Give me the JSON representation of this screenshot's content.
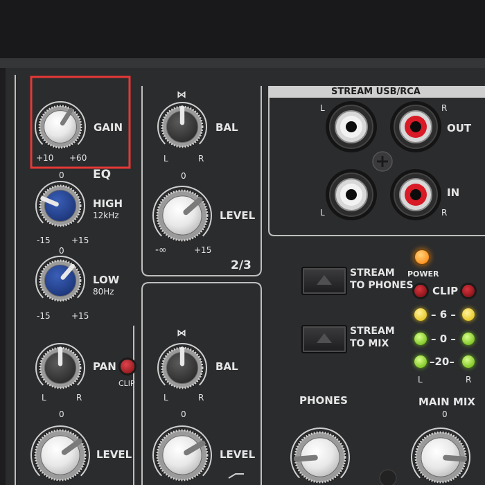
{
  "colors": {
    "panel": "#2b2c2e",
    "top_strip": "#1a1a1c",
    "line": "#c8c8c8",
    "highlight": "#e53935",
    "eq_knob": "#1f3f8c",
    "led_power": "#ff8a00",
    "led_clip": "#b3121b",
    "led_yellow": "#f4d21a",
    "led_green": "#7bd21a"
  },
  "channel1": {
    "gain": {
      "label": "GAIN",
      "min": "+10",
      "max": "+60",
      "value": 0.62
    },
    "eq_title": "EQ",
    "high": {
      "label": "HIGH",
      "freq": "12kHz",
      "top": "0",
      "min": "-15",
      "max": "+15",
      "value": 0.25
    },
    "low": {
      "label": "LOW",
      "freq": "80Hz",
      "top": "0",
      "min": "-15",
      "max": "+15",
      "value": 0.65
    },
    "pan": {
      "label": "PAN",
      "left": "L",
      "right": "R",
      "value": 0.5
    },
    "clip_label": "CLIP",
    "level": {
      "label": "LEVEL",
      "top": "0",
      "value": 0.7
    }
  },
  "channel23": {
    "bal": {
      "label": "BAL",
      "left": "L",
      "right": "R",
      "value": 0.5
    },
    "level": {
      "label": "LEVEL",
      "top": "0",
      "min": "-∞",
      "max": "+15",
      "value": 0.68
    },
    "name": "2/3"
  },
  "channel45": {
    "bal": {
      "label": "BAL",
      "left": "L",
      "right": "R",
      "value": 0.5
    },
    "level": {
      "label": "LEVEL",
      "top": "0",
      "value": 0.72
    }
  },
  "stream": {
    "title": "STREAM USB/RCA",
    "out_label": "OUT",
    "in_label": "IN",
    "left": "L",
    "right": "R",
    "to_phones_line1": "STREAM",
    "to_phones_line2": "TO PHONES",
    "to_mix_line1": "STREAM",
    "to_mix_line2": "TO MIX"
  },
  "meter": {
    "power_label": "POWER",
    "clip_label": "CLIP",
    "level_6": "– 6 –",
    "level_0": "– 0 –",
    "level_20": "–20–",
    "left": "L",
    "right": "R"
  },
  "phones": {
    "label": "PHONES",
    "value": 0.15
  },
  "main_mix": {
    "label": "MAIN MIX",
    "top": "0",
    "value": 0.85
  }
}
